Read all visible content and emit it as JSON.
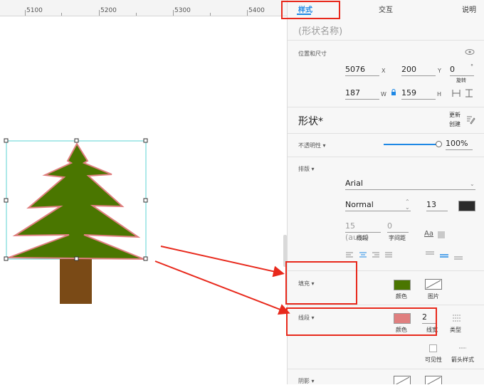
{
  "ruler": {
    "labels": [
      "5100",
      "5200",
      "5300",
      "5400"
    ]
  },
  "colors": {
    "accent": "#1e88e5",
    "fill": "#4a7600",
    "stroke": "#e07f7f",
    "trunk": "#7a4a16",
    "annot_red": "#e8291c"
  },
  "panel": {
    "tabs": [
      "样式",
      "交互",
      "说明"
    ],
    "shape_name_placeholder": "(形状名称)",
    "position_size": {
      "label": "位置和尺寸",
      "x_value": "5076",
      "x_unit": "X",
      "y_value": "200",
      "y_unit": "Y",
      "rotation_value": "0",
      "rotation_unit": "°",
      "rotation_label": "旋转",
      "w_value": "187",
      "w_unit": "W",
      "h_value": "159",
      "h_unit": "H"
    },
    "shape": {
      "title": "形状*",
      "update_label": "更新",
      "create_label": "创建"
    },
    "opacity": {
      "label": "不透明性 ▾",
      "value": "100%",
      "level": 1.0
    },
    "typography": {
      "label": "排版 ▾",
      "font": "Arial",
      "weight": "Normal",
      "size": "13",
      "line_height": "15 (auto)",
      "line_height_label": "线段",
      "letter_spacing": "0",
      "letter_spacing_label": "字间距",
      "aa_label": "Aa"
    },
    "fill": {
      "label": "填充 ▾",
      "color_label": "颜色",
      "image_label": "图片"
    },
    "stroke": {
      "label": "线段 ▾",
      "color_label": "颜色",
      "width": "2",
      "width_label": "线宽",
      "type_label": "类型",
      "visibility_label": "可见性",
      "arrow_label": "箭头样式"
    },
    "shadow": {
      "label": "阴影 ▾"
    }
  }
}
